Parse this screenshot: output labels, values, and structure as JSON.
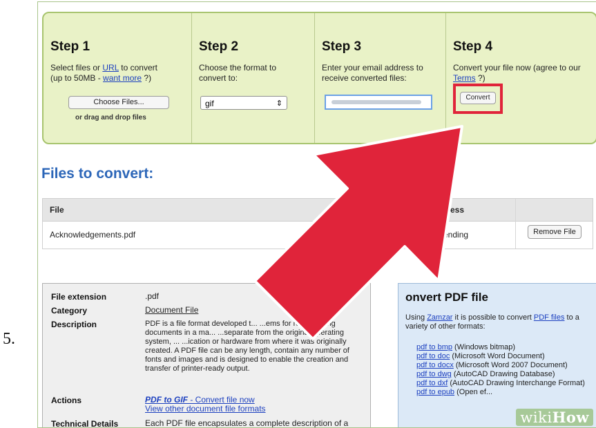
{
  "step_number": "5.",
  "steps": [
    {
      "title": "Step 1",
      "desc_a": "Select files or ",
      "desc_link": "URL",
      "desc_b": " to convert",
      "desc_c": "(up to 50MB - ",
      "desc_link2": "want more",
      "desc_d": " ?)",
      "button": "Choose Files...",
      "note": "or drag and drop files"
    },
    {
      "title": "Step 2",
      "desc": "Choose the format to convert to:",
      "select_value": "gif",
      "select_arrow": "⇕"
    },
    {
      "title": "Step 3",
      "desc": "Enter your email address to receive converted files:"
    },
    {
      "title": "Step 4",
      "desc_a": "Convert your file now (agree to our ",
      "desc_link": "Terms",
      "desc_b": " ?)",
      "button": "Convert"
    }
  ],
  "files_heading": "Files to convert:",
  "table": {
    "headers": [
      "File",
      "rogress"
    ],
    "row": {
      "file": "Acknowledgements.pdf",
      "status": "Pending",
      "action": "Remove File"
    }
  },
  "info": {
    "rows": [
      {
        "key": "File extension",
        "value": ".pdf"
      },
      {
        "key": "Category",
        "value": "Document File"
      },
      {
        "key": "Description",
        "value": "PDF is a file format developed t... ...ems for representing documents in a ma... ...separate from the original operating system, ... ...ication or hardware from where it was originally created. A PDF file can be any length, contain any number of fonts and images and is designed to enable the creation and transfer of printer-ready output."
      },
      {
        "key": "Actions",
        "value": "PDF to GIF",
        "value_b": " - Convert file now",
        "value_c": "View other document file formats"
      },
      {
        "key": "Technical Details",
        "value": "Each PDF file encapsulates a complete description of a"
      }
    ]
  },
  "side": {
    "title": "onvert PDF file",
    "intro_a": "Using ",
    "intro_link": "Zamzar",
    "intro_b": " it is possible to convert ",
    "intro_link2": "PDF files",
    "intro_c": " to a variety of other formats:",
    "items": [
      {
        "link": "pdf to bmp",
        "text": " (Windows bitmap)"
      },
      {
        "link": "pdf to doc",
        "text": " (Microsoft Word Document)"
      },
      {
        "link": "pdf to docx",
        "text": " (Microsoft Word 2007 Document)"
      },
      {
        "link": "pdf to dwg",
        "text": " (AutoCAD Drawing Database)"
      },
      {
        "link": "pdf to dxf",
        "text": " (AutoCAD Drawing Interchange Format)"
      },
      {
        "link": "pdf to epub",
        "text": " (Open ef..."
      }
    ]
  },
  "watermark": {
    "a": "wiki",
    "b": "How"
  },
  "colors": {
    "panel_bg": "#e9f2c7",
    "arrow": "#e0243a",
    "heading": "#2c66b8",
    "link": "#1b3fbf"
  }
}
